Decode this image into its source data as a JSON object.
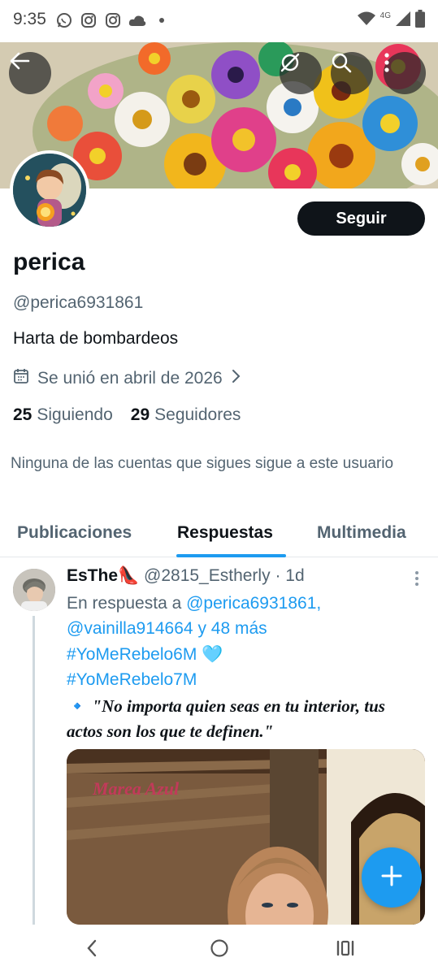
{
  "status_bar": {
    "time": "9:35",
    "network": "4G",
    "icons": [
      "whatsapp-icon",
      "instagram-icon",
      "instagram-icon",
      "cloud-icon",
      "dot-icon",
      "wifi-icon",
      "signal-icon",
      "battery-icon"
    ]
  },
  "header": {
    "back_icon": "arrow-left-icon",
    "actions": [
      "grok-icon",
      "search-icon",
      "more-vertical-icon"
    ]
  },
  "profile": {
    "follow_label": "Seguir",
    "display_name": "perica",
    "handle": "@perica6931861",
    "bio": "Harta de bombardeos",
    "joined": "Se unió en abril de 2026",
    "following_count": "25",
    "following_label": "Siguiendo",
    "followers_count": "29",
    "followers_label": "Seguidores",
    "mutual_note": "Ninguna de las cuentas que sigues sigue a este usuario"
  },
  "tabs": {
    "items": [
      {
        "label": "Publicaciones",
        "active": false
      },
      {
        "label": "Respuestas",
        "active": true
      },
      {
        "label": "Multimedia",
        "active": false
      }
    ]
  },
  "post": {
    "author_name": "EsThe👠",
    "author_handle": "@2815_Estherly",
    "separator": "·",
    "time": "1d",
    "reply_prefix": "En respuesta a",
    "reply_user_1": "@perica6931861,",
    "reply_user_2": "@vainilla914664",
    "reply_suffix": "y 48 más",
    "hashtag_1": "#YoMeRebelo6M",
    "heart": "🩵",
    "hashtag_2": "#YoMeRebelo7M",
    "quote_marker": "🔹",
    "quote_text": "\"No importa quien seas en tu interior, tus actos son los que te definen.\"",
    "image_caption": "Marea Azul"
  },
  "colors": {
    "accent": "#1d9bf0",
    "text_primary": "#0f1419",
    "text_secondary": "#536471",
    "button_dark": "#0f1419"
  }
}
